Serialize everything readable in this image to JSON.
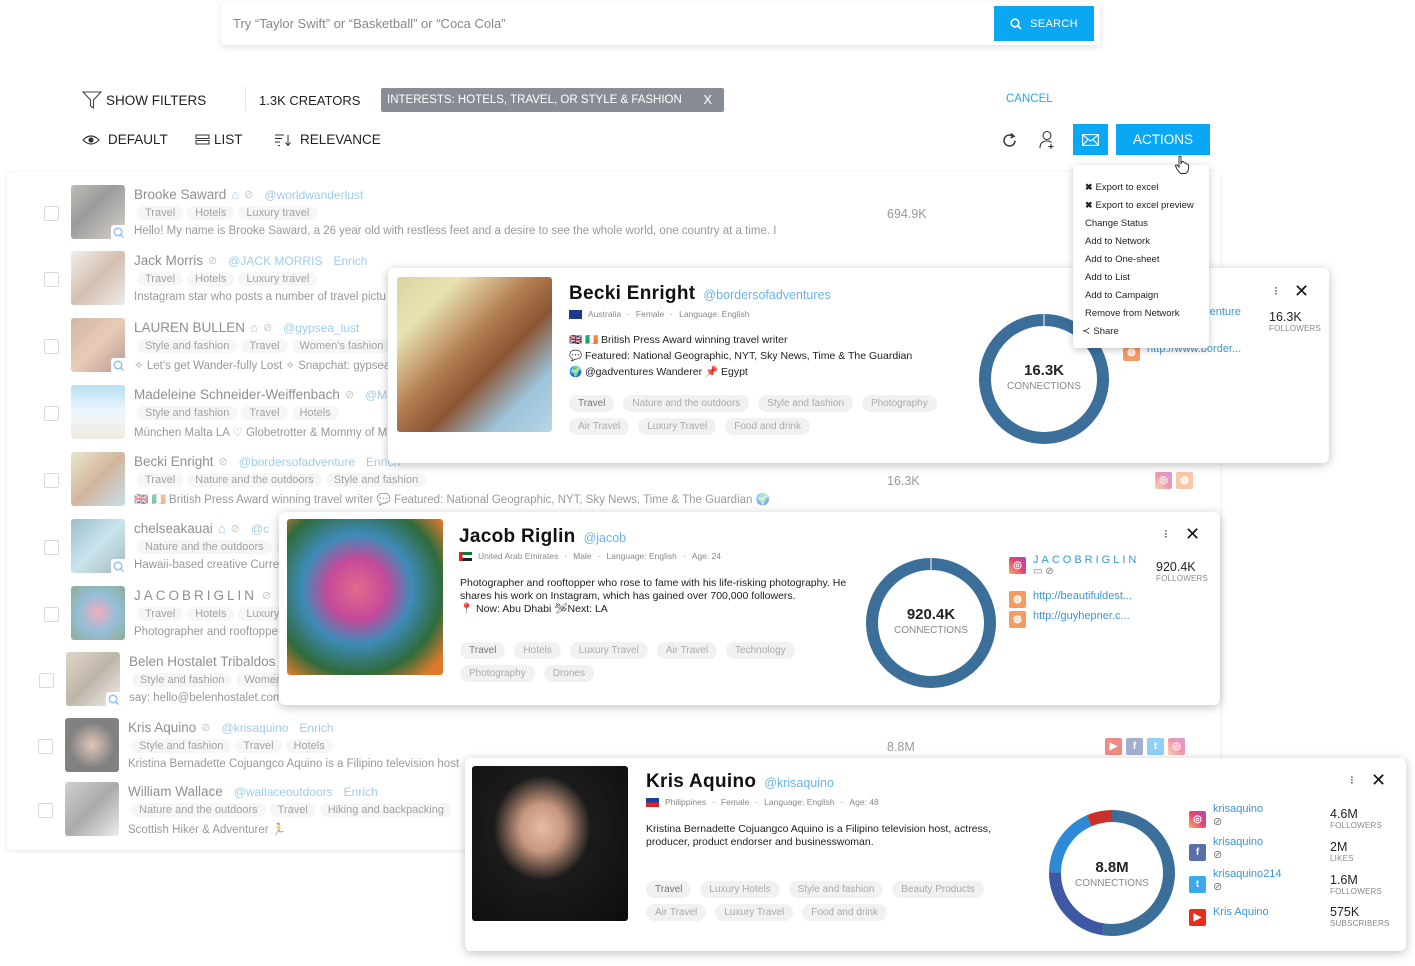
{
  "search": {
    "placeholder": "Try “Taylor Swift” or “Basketball” or “Coca Cola”",
    "button_label": "SEARCH"
  },
  "toolbar": {
    "show_filters": "SHOW FILTERS",
    "creators_count": "1.3K CREATORS",
    "filter_chip": "INTERESTS: HOTELS, TRAVEL, OR STYLE & FASHION",
    "filter_chip_close": "X",
    "cancel": "CANCEL",
    "view_default": "DEFAULT",
    "view_list": "LIST",
    "sort_relevance": "RELEVANCE",
    "actions": "ACTIONS"
  },
  "actions_menu": [
    {
      "label": "Export to excel",
      "icon": "excel-icon"
    },
    {
      "label": "Export to excel preview",
      "icon": "excel-icon"
    },
    {
      "label": "Change Status"
    },
    {
      "label": "Add to Network"
    },
    {
      "label": "Add to One-sheet"
    },
    {
      "label": "Add to List"
    },
    {
      "label": "Add to Campaign"
    },
    {
      "label": "Remove from Network"
    },
    {
      "label": "Share",
      "icon": "share-icon"
    }
  ],
  "creators": [
    {
      "name": "Brooke Saward",
      "handle": "@worldwanderlust",
      "enrich": "",
      "tags": [
        "Travel",
        "Hotels",
        "Luxury travel"
      ],
      "desc": "Hello! My name is Brooke Saward, a 26 year old with restless feet and a desire to see the whole world, one country at a time. I",
      "count": "694.9K",
      "home": true
    },
    {
      "name": "Jack Morris",
      "handle": "@JACK MORRIS",
      "enrich": "Enrich",
      "tags": [
        "Travel",
        "Hotels",
        "Luxury travel"
      ],
      "desc": "Instagram star who posts a number of travel pictu",
      "count": ""
    },
    {
      "name": "LAUREN BULLEN",
      "handle": "@gypsea_lust",
      "enrich": "",
      "tags": [
        "Style and fashion",
        "Travel",
        "Women's fashion"
      ],
      "desc": "✧ Let's get Wander-fully Lost ✧ Snapchat: gypsea",
      "count": "",
      "home": true
    },
    {
      "name": "Madeleine Schneider-Weiffenbach",
      "handle": "@M",
      "enrich": "",
      "tags": [
        "Style and fashion",
        "Travel",
        "Hotels"
      ],
      "desc": "München Malta LA ♡ Globetrotter & Mommy of M",
      "count": ""
    },
    {
      "name": "Becki Enright",
      "handle": "@bordersofadventure",
      "enrich": "Enrich",
      "tags": [
        "Travel",
        "Nature and the outdoors",
        "Style and fashion"
      ],
      "desc": "🇬🇧 🇮🇪 British Press Award winning travel writer 💬 Featured: National Geographic, NYT, Sky News, Time & The Guardian 🌍",
      "count": "16.3K"
    },
    {
      "name": "chelseakauai",
      "handle": "@c",
      "enrich": "",
      "tags": [
        "Nature and the outdoors",
        "T"
      ],
      "desc": "Hawaii-based creative Curre",
      "count": "",
      "home": true
    },
    {
      "name": "JACOBRIGLIN",
      "handle": "",
      "enrich": "",
      "tags": [
        "Travel",
        "Hotels",
        "Luxury tr"
      ],
      "desc": "Photographer and rooftoppe",
      "count": ""
    },
    {
      "name": "Belen Hostalet Tribaldos",
      "handle": "",
      "enrich": "",
      "tags": [
        "Style and fashion",
        "Women's"
      ],
      "desc": "say: hello@belenhostalet.com",
      "count": ""
    },
    {
      "name": "Kris Aquino",
      "handle": "@krisaquino",
      "enrich": "Enrich",
      "tags": [
        "Style and fashion",
        "Travel",
        "Hotels"
      ],
      "desc": "Kristina Bernadette Cojuangco Aquino is a Filipino television host",
      "count": "8.8M"
    },
    {
      "name": "William Wallace",
      "handle": "@wallaceoutdoors",
      "enrich": "Enrich",
      "tags": [
        "Nature and the outdoors",
        "Travel",
        "Hiking and backpacking"
      ],
      "desc": "Scottish Hiker & Adventurer 🏃",
      "count": ""
    }
  ],
  "popups": {
    "becki": {
      "name": "Becki Enright",
      "handle": "@bordersofadventures",
      "country": "Australia",
      "gender": "Female",
      "language": "Language: English",
      "bio": [
        "🇬🇧 🇮🇪 British Press Award winning travel writer",
        "💬 Featured: National Geographic, NYT, Sky News, Time & The Guardian",
        "🌍 @gadventures Wanderer 📌 Egypt"
      ],
      "tags": [
        "Travel",
        "Nature and the outdoors",
        "Style and fashion",
        "Photography",
        "Air Travel",
        "Luxury Travel",
        "Food and drink"
      ],
      "connections": "16.3K",
      "connections_label": "CONNECTIONS",
      "networks": [
        {
          "name": "dventure"
        },
        {
          "name": "http://www.border..."
        }
      ],
      "stats": [
        {
          "value": "16.3K",
          "label": "FOLLOWERS"
        }
      ]
    },
    "jacob": {
      "name": "Jacob Riglin",
      "handle": "@jacob",
      "country": "United Arab Emirates",
      "gender": "Male",
      "language": "Language: English",
      "age": "Age: 24",
      "bio": "Photographer and rooftopper who rose to fame with his life-risking photography. He shares his work on Instagram, which has gained over 700,000 followers.",
      "bio2": "📍 Now: Abu Dhabi 🛩Next: LA",
      "tags": [
        "Travel",
        "Hotels",
        "Luxury Travel",
        "Air Travel",
        "Technology",
        "Photography",
        "Drones"
      ],
      "connections": "920.4K",
      "connections_label": "CONNECTIONS",
      "networks": [
        {
          "name": "JACOBRIGLIN"
        },
        {
          "name": "http://beautifuldest..."
        },
        {
          "name": "http://guyhepner.c..."
        }
      ],
      "stats": [
        {
          "value": "920.4K",
          "label": "FOLLOWERS"
        }
      ]
    },
    "kris": {
      "name": "Kris Aquino",
      "handle": "@krisaquino",
      "country": "Philippines",
      "gender": "Female",
      "language": "Language: English",
      "age": "Age: 48",
      "bio": "Kristina Bernadette Cojuangco Aquino is a Filipino television host, actress, producer, product endorser and businesswoman.",
      "tags": [
        "Travel",
        "Luxury Hotels",
        "Style and fashion",
        "Beauty Products",
        "Air Travel",
        "Luxury Travel",
        "Food and drink"
      ],
      "connections": "8.8M",
      "connections_label": "CONNECTIONS",
      "networks": [
        {
          "name": "krisaquino"
        },
        {
          "name": "krisaquino"
        },
        {
          "name": "krisaquino214"
        },
        {
          "name": "Kris Aquino"
        }
      ],
      "stats": [
        {
          "value": "4.6M",
          "label": "FOLLOWERS"
        },
        {
          "value": "2M",
          "label": "LIKES"
        },
        {
          "value": "1.6M",
          "label": "FOLLOWERS"
        },
        {
          "value": "575K",
          "label": "SUBSCRIBERS"
        }
      ],
      "donut_shares": [
        {
          "network": "instagram",
          "value": 4.6,
          "color": "#3b6f9a"
        },
        {
          "network": "facebook",
          "value": 2.0,
          "color": "#3f58a5"
        },
        {
          "network": "twitter",
          "value": 1.6,
          "color": "#2e8ad6"
        },
        {
          "network": "youtube",
          "value": 0.575,
          "color": "#c8302a"
        }
      ]
    }
  },
  "colors": {
    "accent": "#0aa7f5",
    "donut": "#3b6f9a",
    "link": "#3a96d4"
  }
}
